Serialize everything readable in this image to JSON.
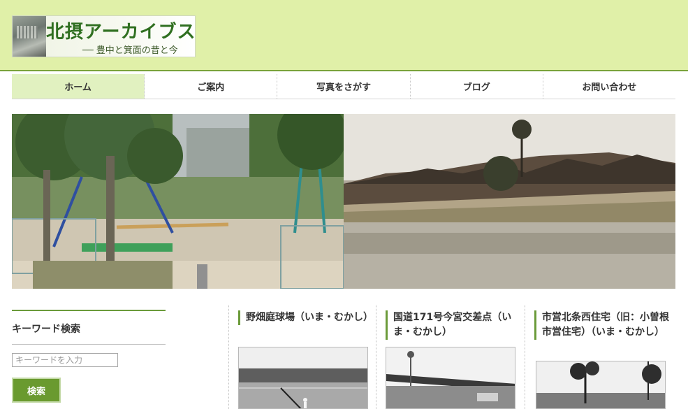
{
  "header": {
    "logo_title": "北摂アーカイブス",
    "logo_subtitle": "── 豊中と箕面の昔と今"
  },
  "nav": {
    "items": [
      {
        "label": "ホーム",
        "active": true
      },
      {
        "label": "ご案内",
        "active": false
      },
      {
        "label": "写真をさがす",
        "active": false
      },
      {
        "label": "ブログ",
        "active": false
      },
      {
        "label": "お問い合わせ",
        "active": false
      }
    ]
  },
  "sidebar": {
    "heading": "キーワード検索",
    "search_placeholder": "キーワードを入力",
    "search_button": "検索"
  },
  "cards": [
    {
      "title": "野畑庭球場（いま・むかし）"
    },
    {
      "title": "国道171号今宮交差点（いま・むかし）"
    },
    {
      "title": "市営北条西住宅（旧：小曽根市営住宅）（いま・むかし）"
    }
  ],
  "colors": {
    "header_bg": "#e0f0a8",
    "accent_green": "#6b9b3a",
    "nav_active_bg": "#e1f1c0",
    "button_bg": "#6a9a2f"
  }
}
